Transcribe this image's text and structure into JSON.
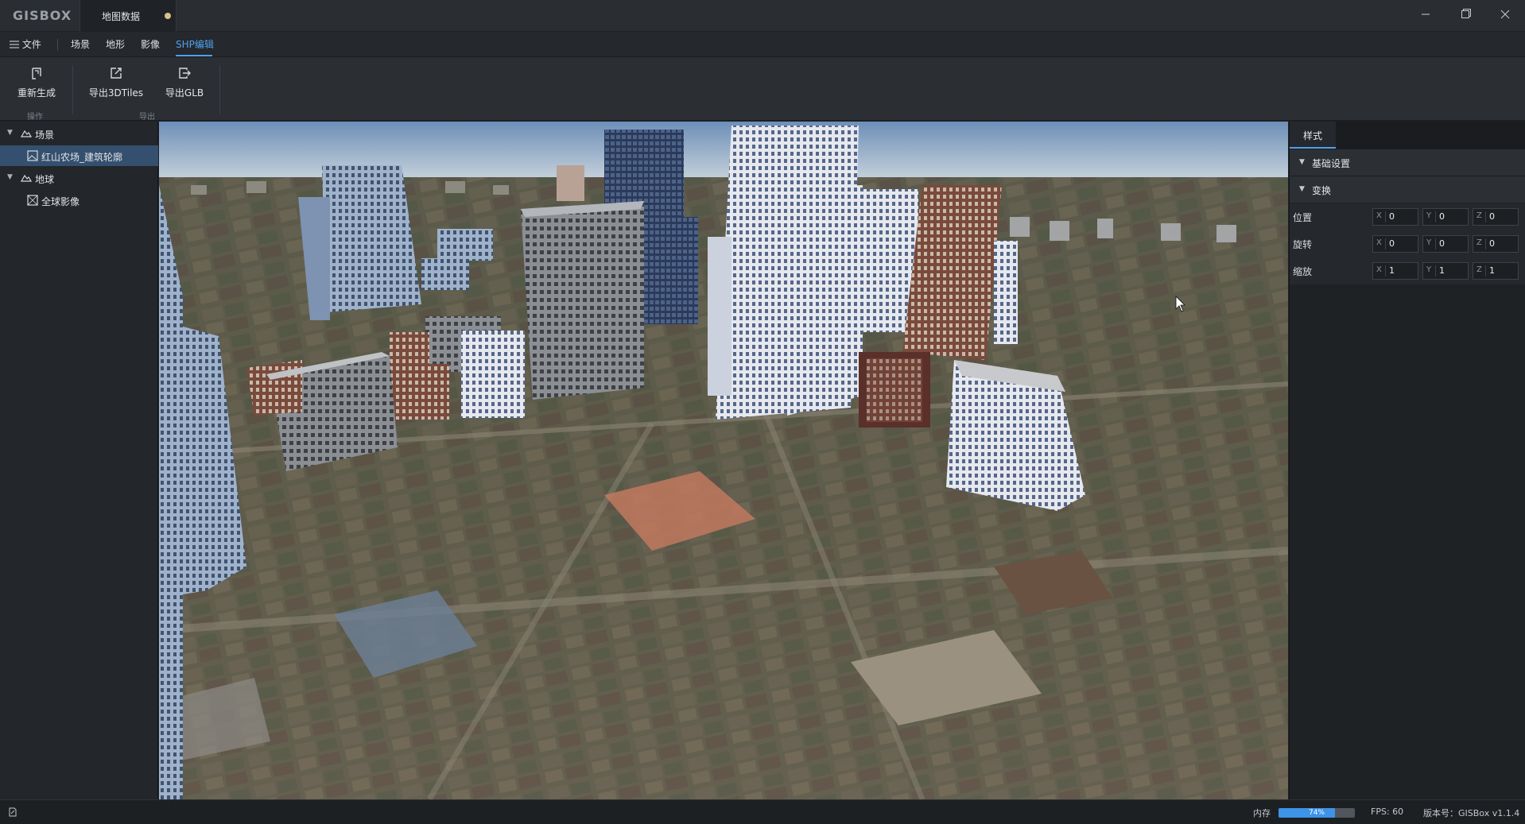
{
  "app": {
    "logo": "GISBOX",
    "tab_title": "地图数据"
  },
  "menu": {
    "file_label": "文件",
    "items": [
      "场景",
      "地形",
      "影像",
      "SHP编辑"
    ],
    "active_index": 3
  },
  "ribbon": {
    "regenerate_label": "重新生成",
    "operate_group_label": "操作",
    "export_3dtiles_label": "导出3DTiles",
    "export_glb_label": "导出GLB",
    "export_group_label": "导出"
  },
  "tree": {
    "scene_label": "场景",
    "scene_child_label": "红山农场_建筑轮廓",
    "earth_label": "地球",
    "earth_child_label": "全球影像"
  },
  "panel": {
    "tab_label": "样式",
    "basic_settings_label": "基础设置",
    "transform_label": "变换",
    "axes": [
      "X",
      "Y",
      "Z"
    ],
    "position_label": "位置",
    "position_values": [
      "0",
      "0",
      "0"
    ],
    "rotation_label": "旋转",
    "rotation_values": [
      "0",
      "0",
      "0"
    ],
    "scale_label": "缩放",
    "scale_values": [
      "1",
      "1",
      "1"
    ]
  },
  "status": {
    "memory_label": "内存",
    "memory_percent_text": "74%",
    "memory_fraction": 0.74,
    "fps_text": "FPS: 60",
    "version_text": "版本号：GISBox v1.1.4"
  },
  "colors": {
    "accent": "#4ea1f0",
    "selected_row": "#34506e",
    "unsaved_dot": "#d8c08a"
  }
}
